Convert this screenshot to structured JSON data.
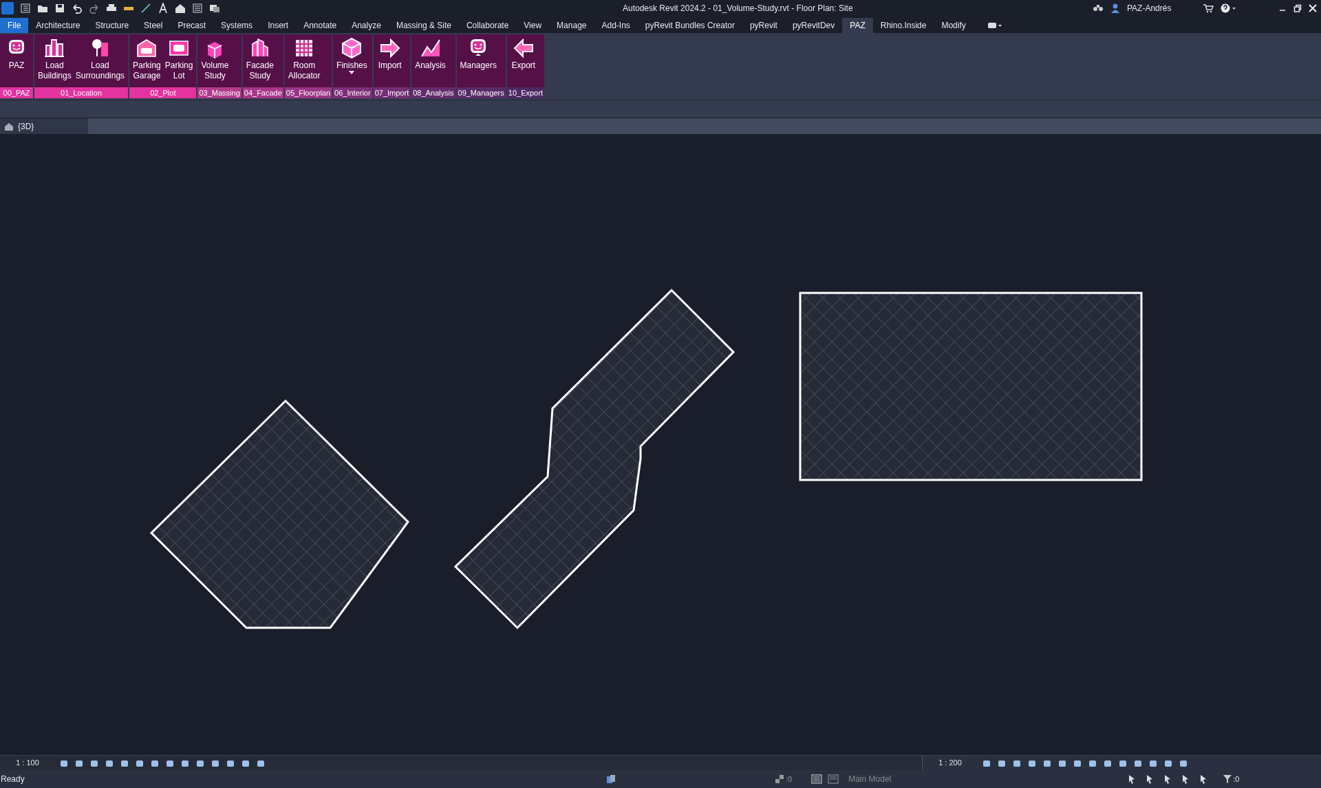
{
  "window": {
    "title": "Autodesk Revit 2024.2 - 01_Volume-Study.rvt - Floor Plan: Site",
    "user": "PAZ-Andrés"
  },
  "ribbon_tabs": [
    {
      "label": "File",
      "kind": "file",
      "selected": false
    },
    {
      "label": "Architecture",
      "kind": "tab",
      "selected": false
    },
    {
      "label": "Structure",
      "kind": "tab",
      "selected": false
    },
    {
      "label": "Steel",
      "kind": "tab",
      "selected": false
    },
    {
      "label": "Precast",
      "kind": "tab",
      "selected": false
    },
    {
      "label": "Systems",
      "kind": "tab",
      "selected": false
    },
    {
      "label": "Insert",
      "kind": "tab",
      "selected": false
    },
    {
      "label": "Annotate",
      "kind": "tab",
      "selected": false
    },
    {
      "label": "Analyze",
      "kind": "tab",
      "selected": false
    },
    {
      "label": "Massing & Site",
      "kind": "tab",
      "selected": false
    },
    {
      "label": "Collaborate",
      "kind": "tab",
      "selected": false
    },
    {
      "label": "View",
      "kind": "tab",
      "selected": false
    },
    {
      "label": "Manage",
      "kind": "tab",
      "selected": false
    },
    {
      "label": "Add-Ins",
      "kind": "tab",
      "selected": false
    },
    {
      "label": "pyRevit Bundles Creator",
      "kind": "tab",
      "selected": false
    },
    {
      "label": "pyRevit",
      "kind": "tab",
      "selected": false
    },
    {
      "label": "pyRevitDev",
      "kind": "tab",
      "selected": false
    },
    {
      "label": "PAZ",
      "kind": "tab",
      "selected": true
    },
    {
      "label": "Rhino.Inside",
      "kind": "tab",
      "selected": false
    },
    {
      "label": "Modify",
      "kind": "tab",
      "selected": false
    }
  ],
  "ribbon_panels": [
    {
      "label": "00_PAZ",
      "color": "#e2339f",
      "buttons": [
        {
          "label": "PAZ",
          "dropdown": false
        }
      ]
    },
    {
      "label": "01_Location",
      "color": "#e2339f",
      "buttons": [
        {
          "label": "Load Buildings",
          "dropdown": false
        },
        {
          "label": "Load Surroundings",
          "dropdown": false
        }
      ]
    },
    {
      "label": "02_Plot",
      "color": "#e2339f",
      "buttons": [
        {
          "label": "Parking Garage",
          "dropdown": false
        },
        {
          "label": "Parking Lot",
          "dropdown": false
        }
      ]
    },
    {
      "label": "03_Massing",
      "color": "#b13a8c",
      "buttons": [
        {
          "label": "Volume Study",
          "dropdown": false
        }
      ]
    },
    {
      "label": "04_Facade",
      "color": "#a9378a",
      "buttons": [
        {
          "label": "Facade Study",
          "dropdown": false
        }
      ]
    },
    {
      "label": "05_Floorplan",
      "color": "#9b3585",
      "buttons": [
        {
          "label": "Room Allocator",
          "dropdown": false
        }
      ]
    },
    {
      "label": "06_Interior",
      "color": "#7f2f78",
      "buttons": [
        {
          "label": "Finishes",
          "dropdown": true
        }
      ]
    },
    {
      "label": "07_Import",
      "color": "#742e74",
      "buttons": [
        {
          "label": "Import",
          "dropdown": false
        }
      ]
    },
    {
      "label": "08_Analysis",
      "color": "#642b6c",
      "buttons": [
        {
          "label": "Analysis",
          "dropdown": false
        }
      ]
    },
    {
      "label": "09_Managers",
      "color": "#592a68",
      "buttons": [
        {
          "label": "Managers",
          "dropdown": false
        }
      ]
    },
    {
      "label": "10_Export",
      "color": "#4e2964",
      "buttons": [
        {
          "label": "Export",
          "dropdown": false
        }
      ]
    }
  ],
  "view_tabs": [
    {
      "label": "{3D}",
      "selected": true
    }
  ],
  "view_bars": [
    {
      "scale": "1 : 100"
    },
    {
      "scale": "1 : 200"
    }
  ],
  "status_bar": {
    "text": "Ready",
    "worksets_count": ":0",
    "model": "Main Model",
    "filter_count": ":0"
  }
}
